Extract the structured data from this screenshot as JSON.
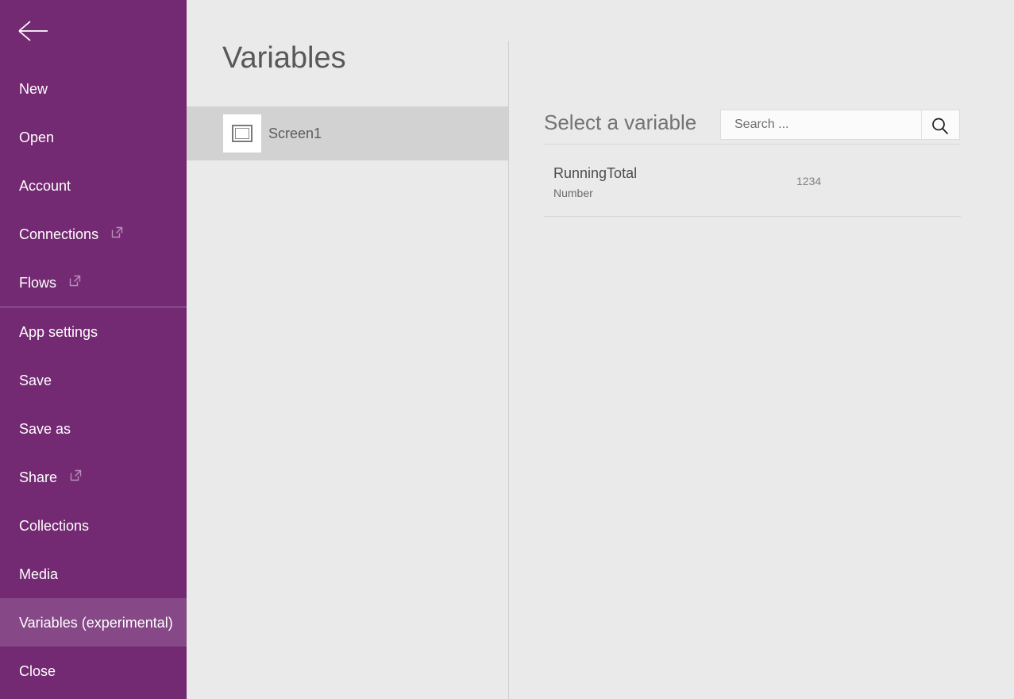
{
  "sidebar": {
    "back_icon": "back-arrow-icon",
    "items": [
      {
        "label": "New",
        "external": false,
        "selected": false,
        "separator_after": false
      },
      {
        "label": "Open",
        "external": false,
        "selected": false,
        "separator_after": false
      },
      {
        "label": "Account",
        "external": false,
        "selected": false,
        "separator_after": false
      },
      {
        "label": "Connections",
        "external": true,
        "selected": false,
        "separator_after": false
      },
      {
        "label": "Flows",
        "external": true,
        "selected": false,
        "separator_after": true
      },
      {
        "label": "App settings",
        "external": false,
        "selected": false,
        "separator_after": false
      },
      {
        "label": "Save",
        "external": false,
        "selected": false,
        "separator_after": false
      },
      {
        "label": "Save as",
        "external": false,
        "selected": false,
        "separator_after": false
      },
      {
        "label": "Share",
        "external": true,
        "selected": false,
        "separator_after": false
      },
      {
        "label": "Collections",
        "external": false,
        "selected": false,
        "separator_after": false
      },
      {
        "label": "Media",
        "external": false,
        "selected": false,
        "separator_after": false
      },
      {
        "label": "Variables (experimental)",
        "external": false,
        "selected": true,
        "separator_after": false
      },
      {
        "label": "Close",
        "external": false,
        "selected": false,
        "separator_after": false
      }
    ],
    "colors": {
      "background": "#732a72",
      "selected": "#864887",
      "text": "#ffffff",
      "separator": "#a273a4"
    }
  },
  "screens_panel": {
    "title": "Variables",
    "screens": [
      {
        "name": "Screen1",
        "icon": "screen-thumbnail-icon",
        "selected": true
      }
    ]
  },
  "variables_panel": {
    "heading": "Select a variable",
    "search": {
      "placeholder": "Search ...",
      "value": "",
      "icon": "search-icon"
    },
    "variables": [
      {
        "name": "RunningTotal",
        "type": "Number",
        "value": "1234"
      }
    ]
  }
}
